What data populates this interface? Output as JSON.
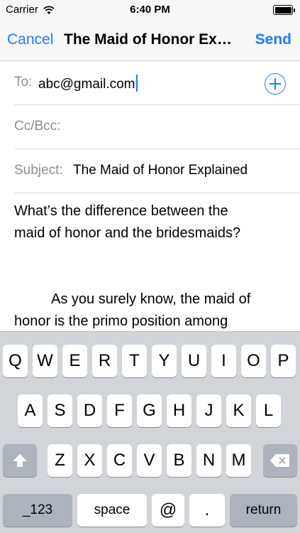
{
  "status_bar": {
    "carrier": "Carrier",
    "time": "6:40 PM"
  },
  "nav": {
    "cancel_label": "Cancel",
    "title": "The Maid of Honor Ex…",
    "send_label": "Send"
  },
  "to_field": {
    "label": "To:",
    "value": "abc@gmail.com"
  },
  "cc_field": {
    "label": "Cc/Bcc:"
  },
  "subject_field": {
    "label": "Subject:",
    "value": "The Maid of Honor Explained"
  },
  "body": {
    "paragraph1_line1": "What’s the difference between the",
    "paragraph1_line2": "maid of honor and the bridesmaids?",
    "paragraph2_line1": "As you surely know, the maid of",
    "paragraph2_line2": "honor is the primo position among"
  },
  "keyboard": {
    "row1": [
      "Q",
      "W",
      "E",
      "R",
      "T",
      "Y",
      "U",
      "I",
      "O",
      "P"
    ],
    "row2": [
      "A",
      "S",
      "D",
      "F",
      "G",
      "H",
      "J",
      "K",
      "L"
    ],
    "row3": [
      "Z",
      "X",
      "C",
      "V",
      "B",
      "N",
      "M"
    ],
    "numbers_label": "_123",
    "space_label": "space",
    "at_label": "@",
    "period_label": ".",
    "return_label": "return"
  },
  "colors": {
    "accent": "#1a7ff5",
    "keyboard_bg": "#d1d4d9",
    "dark_key": "#acb3bc"
  },
  "icons": {
    "wifi": "wifi-icon",
    "battery": "battery-icon",
    "add_contact": "plus-circle-icon",
    "shift": "shift-arrow-icon",
    "delete": "backspace-icon"
  }
}
